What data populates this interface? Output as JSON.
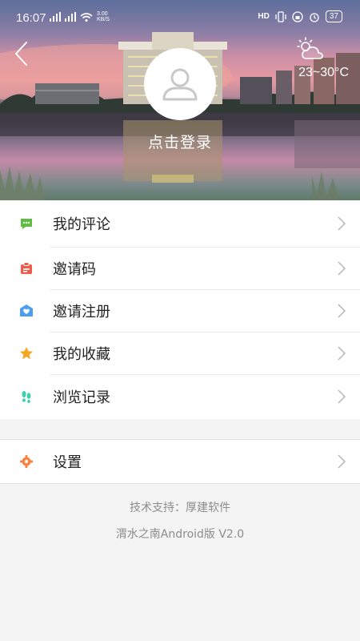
{
  "status_bar": {
    "time": "16:07",
    "net_speed": "3.00 KB/S",
    "battery": "37"
  },
  "header": {
    "back_icon": "chevron-left-icon",
    "weather_icon": "sun-cloud-icon",
    "temperature": "23~30°C",
    "avatar_icon": "user-avatar-icon",
    "login_label": "点击登录"
  },
  "menu": {
    "items": [
      {
        "label": "我的评论",
        "icon": "comment-icon",
        "color": "#5bbe3e"
      },
      {
        "label": "邀请码",
        "icon": "badge-icon",
        "color": "#ef5a4a"
      },
      {
        "label": "邀请注册",
        "icon": "heart-mail-icon",
        "color": "#4e9ef0"
      },
      {
        "label": "我的收藏",
        "icon": "star-icon",
        "color": "#f7a623"
      },
      {
        "label": "浏览记录",
        "icon": "footprint-icon",
        "color": "#3fd0b0"
      }
    ],
    "settings": {
      "label": "设置",
      "icon": "gear-icon",
      "color": "#ff7e3e"
    }
  },
  "footer": {
    "support": "技术支持：厚建软件",
    "version": "渭水之南Android版 V2.0"
  }
}
